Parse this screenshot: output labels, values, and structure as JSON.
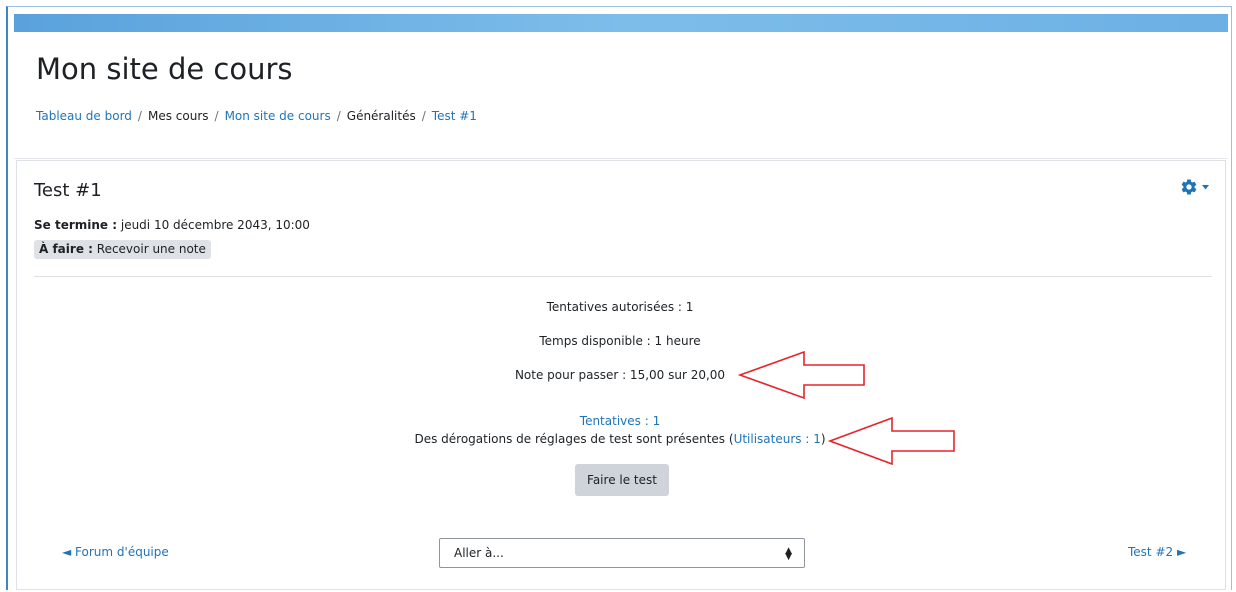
{
  "site": {
    "title": "Mon site de cours"
  },
  "breadcrumb": [
    {
      "label": "Tableau de bord",
      "link": true
    },
    {
      "label": "Mes cours",
      "link": false
    },
    {
      "label": "Mon site de cours",
      "link": true
    },
    {
      "label": "Généralités",
      "link": false
    },
    {
      "label": "Test #1",
      "link": true
    }
  ],
  "quiz": {
    "title": "Test #1",
    "closes_label": "Se termine :",
    "closes_value": "jeudi 10 décembre 2043, 10:00",
    "todo_label": "À faire :",
    "todo_value": "Recevoir une note",
    "attempts_allowed": "Tentatives autorisées : 1",
    "time_limit": "Temps disponible : 1 heure",
    "grade_to_pass": "Note pour passer : 15,00 sur 20,00",
    "attempts_link": "Tentatives : 1",
    "overrides_text": "Des dérogations de réglages de test sont présentes (",
    "overrides_link": "Utilisateurs : 1",
    "overrides_close": ")",
    "start_button": "Faire le test"
  },
  "nav": {
    "prev_label": "◄ Forum d'équipe",
    "jump_label": "Aller à...",
    "next_label": "Test #2 ►"
  },
  "colors": {
    "accent": "#1f74b8",
    "annotation_arrow": "#e3262c",
    "topbar": "#5aa2dc"
  },
  "icons": {
    "settings": "gear-icon",
    "dropdown": "caret-down-icon",
    "select": "updown-caret-icon"
  }
}
